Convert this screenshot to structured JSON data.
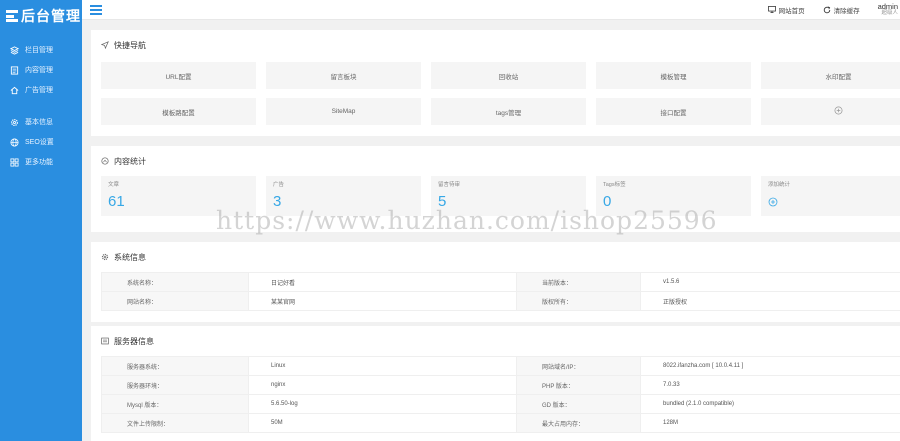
{
  "app": {
    "logo_text": "后台管理"
  },
  "sidebar": {
    "items": [
      {
        "label": "栏目管理",
        "icon": "layers-icon"
      },
      {
        "label": "内容管理",
        "icon": "document-icon"
      },
      {
        "label": "广告管理",
        "icon": "home-icon"
      },
      {
        "label": "基本信息",
        "icon": "gear-icon"
      },
      {
        "label": "SEO设置",
        "icon": "globe-icon"
      },
      {
        "label": "更多功能",
        "icon": "apps-icon"
      }
    ]
  },
  "topbar": {
    "home_label": "网站首页",
    "clear_cache_label": "清除缓存",
    "user_name": "admin",
    "user_role": "超级人"
  },
  "quick_nav": {
    "title": "快捷导航",
    "items": [
      "URL配置",
      "留言板块",
      "回收站",
      "模板管理",
      "水印配置",
      "模板路配置",
      "SiteMap",
      "tags管理",
      "接口配置"
    ]
  },
  "content_stats": {
    "title": "内容统计",
    "cards": [
      {
        "label": "文章",
        "value": "61"
      },
      {
        "label": "广告",
        "value": "3"
      },
      {
        "label": "留言待审",
        "value": "5"
      },
      {
        "label": "Tags标签",
        "value": "0"
      },
      {
        "label": "添加统计",
        "value": ""
      }
    ]
  },
  "system_info": {
    "title": "系统信息",
    "rows": [
      [
        "系统名称：",
        "日记好看",
        "当前版本：",
        "v1.5.6"
      ],
      [
        "网站名称：",
        "某某官网",
        "版权所有：",
        "正版授权"
      ]
    ]
  },
  "server_info": {
    "title": "服务器信息",
    "rows": [
      [
        "服务器系统：",
        "Linux",
        "网站域名/IP：",
        "8022.ifanzha.com [ 10.0.4.11 ]"
      ],
      [
        "服务器环境：",
        "nginx",
        "PHP 版本：",
        "7.0.33"
      ],
      [
        "Mysql 版本：",
        "5.6.50-log",
        "GD 版本：",
        "bundled (2.1.0 compatible)"
      ],
      [
        "文件上传限制：",
        "50M",
        "最大占用内存：",
        "128M"
      ]
    ]
  },
  "watermark": {
    "text": "https://www.huzhan.com/ishop25596"
  },
  "colors": {
    "sidebar": "#2a8ee0",
    "accent_value": "#37a8e6",
    "card_bg": "#f5f5f5"
  }
}
